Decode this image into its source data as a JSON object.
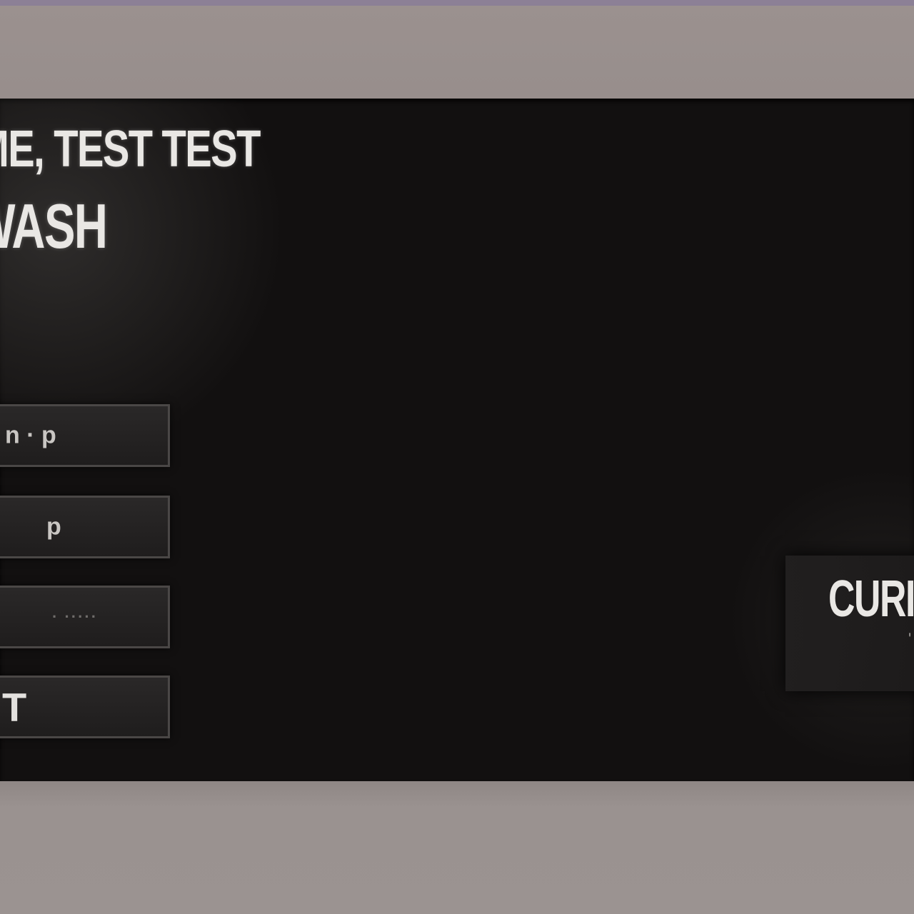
{
  "header": {
    "welcome": "ME, TEST TEST",
    "service": "WASH"
  },
  "menu": {
    "buttons": [
      {
        "label": "n · p"
      },
      {
        "label": "p"
      },
      {
        "label": "· ·····"
      },
      {
        "label": "T"
      }
    ]
  },
  "current_panel": {
    "title": "CURI",
    "subtitle": "'"
  },
  "colors": {
    "screen_background": "#121010",
    "bezel": "#9a9190",
    "text_primary": "#e9e7e4",
    "button_border": "#4a4746"
  }
}
